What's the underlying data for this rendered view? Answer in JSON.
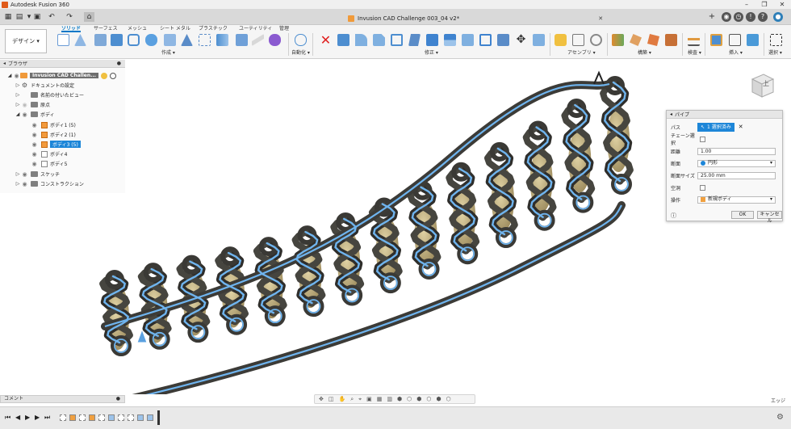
{
  "window": {
    "title": "Autodesk Fusion 360"
  },
  "document_tab": {
    "title": "Invusion CAD Challenge 003_04 v2*"
  },
  "ribbon": {
    "workspace": "デザイン ▾",
    "tabs": [
      "ソリッド",
      "サーフェス",
      "メッシュ",
      "シート メタル",
      "プラスチック",
      "ユーティリティ",
      "管理"
    ],
    "groups": [
      "作成 ▾",
      "自動化 ▾",
      "修正 ▾",
      "アセンブリ ▾",
      "構築 ▾",
      "検査 ▾",
      "挿入 ▾",
      "選択 ▾"
    ]
  },
  "browser": {
    "header": "ブラウザ",
    "items": [
      {
        "label": "Invusion CAD Challen..."
      },
      {
        "label": "ドキュメントの設定"
      },
      {
        "label": "名前の付いたビュー"
      },
      {
        "label": "原点"
      },
      {
        "label": "ボディ"
      },
      {
        "label": "ボディ1 (5)"
      },
      {
        "label": "ボディ2 (1)"
      },
      {
        "label": "ボディ3 (5)"
      },
      {
        "label": "ボディ4"
      },
      {
        "label": "ボディ5"
      },
      {
        "label": "スケッチ"
      },
      {
        "label": "コンストラクション"
      }
    ]
  },
  "viewcube": {
    "face": "上"
  },
  "pipe_dialog": {
    "title": "パイプ",
    "path_label": "パス",
    "path_value": "1 選択済み",
    "chain_label": "チェーン選択",
    "distance_label": "距離",
    "distance_value": "1.00",
    "section_label": "断面",
    "section_value": "円形",
    "section_size_label": "断面サイズ",
    "section_size_value": "25.00 mm",
    "hollow_label": "空洞",
    "operation_label": "操作",
    "operation_value": "新規ボディ",
    "ok": "OK",
    "cancel": "キャンセル"
  },
  "comments": {
    "label": "コメント"
  },
  "status": {
    "selection_type": "エッジ"
  },
  "colors": {
    "accent": "#0078c8",
    "pipe_highlight": "#6fb4ee",
    "body_dark": "#3a3a38",
    "body_core": "#b49a5a"
  }
}
